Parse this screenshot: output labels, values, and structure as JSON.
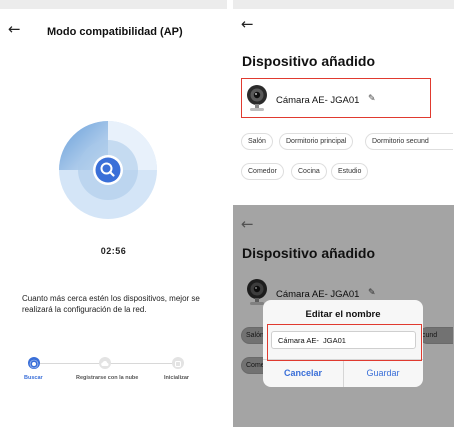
{
  "colors": {
    "accent": "#3a6fd8",
    "highlight": "#e03a2f",
    "radar_light": "#d4e5f7",
    "radar_mid": "#a7c8ea",
    "radar_dark": "#5a96d6"
  },
  "left_screen": {
    "title": "Modo compatibilidad (AP)",
    "back_icon": "←",
    "timer": "02:56",
    "info_text": "Cuanto más cerca estén los dispositivos, mejor se realizará la configuración de la red.",
    "steps": [
      {
        "label": "Buscar",
        "active": true
      },
      {
        "label": "Registrarse con la nube",
        "active": false
      },
      {
        "label": "Inicializar",
        "active": false
      }
    ]
  },
  "top_right_screen": {
    "back_icon": "←",
    "heading": "Dispositivo añadido",
    "device_name": "Cámara AE-  JGA01",
    "edit_icon": "✎",
    "rooms": [
      "Salón",
      "Dormitorio principal",
      "Dormitorio secund",
      "Comedor",
      "Cocina",
      "Estudio"
    ]
  },
  "bottom_right_screen": {
    "back_icon": "←",
    "heading": "Dispositivo añadido",
    "device_name": "Cámara AE-  JGA01",
    "edit_icon": "✎",
    "bg_chips": [
      "Salón",
      "Come",
      "cund"
    ],
    "dialog": {
      "title": "Editar el nombre",
      "input_value": "Cámara AE-  JGA01",
      "cancel_label": "Cancelar",
      "save_label": "Guardar"
    }
  }
}
